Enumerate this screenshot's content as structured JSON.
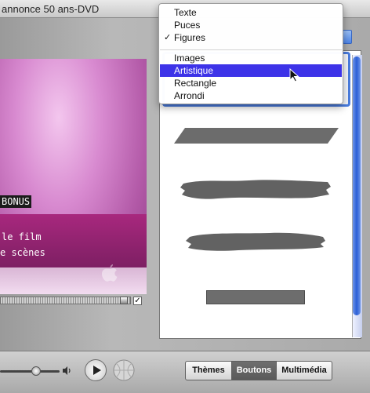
{
  "window": {
    "title": "annonce 50 ans-DVD"
  },
  "preview": {
    "menu_items": [
      "BONUS",
      "le film",
      "e scènes"
    ]
  },
  "dropdown": {
    "items": [
      {
        "label": "Texte",
        "checked": false,
        "selected": false
      },
      {
        "label": "Puces",
        "checked": false,
        "selected": false
      },
      {
        "label": "Figures",
        "checked": true,
        "selected": false
      },
      {
        "label": "Images",
        "checked": false,
        "selected": false
      },
      {
        "label": "Artistique",
        "checked": false,
        "selected": true
      },
      {
        "label": "Rectangle",
        "checked": false,
        "selected": false
      },
      {
        "label": "Arrondi",
        "checked": false,
        "selected": false
      }
    ]
  },
  "bottom": {
    "segments": [
      {
        "label": "Thèmes",
        "active": false
      },
      {
        "label": "Boutons",
        "active": true
      },
      {
        "label": "Multimédia",
        "active": false
      }
    ]
  },
  "colors": {
    "menu_highlight": "#3d33e8",
    "preview_band": "#9a2476",
    "scroll_accent": "#2b5fd6"
  }
}
